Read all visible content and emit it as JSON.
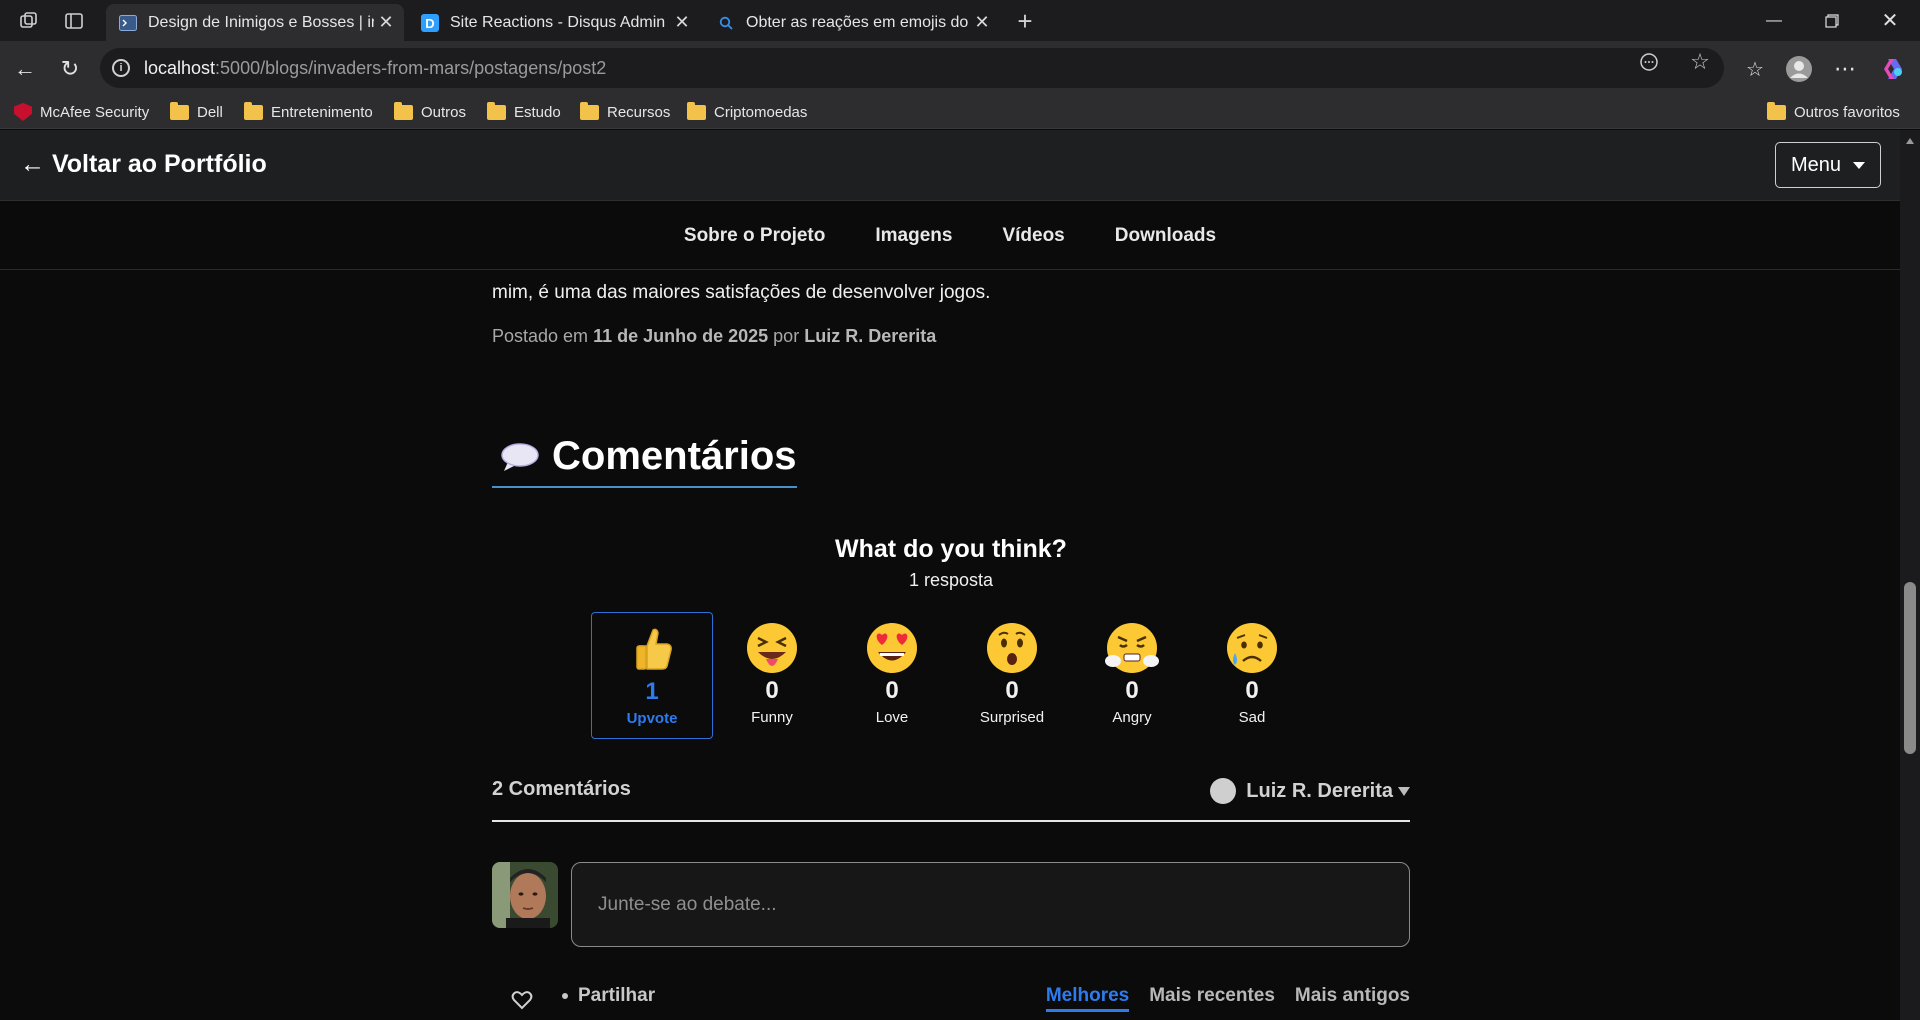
{
  "browser": {
    "tabs": [
      {
        "title": "Design de Inimigos e Bosses | invaders-from-mars",
        "favicon": "terminal-icon",
        "active": true
      },
      {
        "title": "Site Reactions - Disqus Admin",
        "favicon": "disqus-icon",
        "active": false
      },
      {
        "title": "Obter as reações em emojis do disqus",
        "favicon": "search-icon",
        "active": false
      }
    ],
    "url_host": "localhost",
    "url_path": ":5000/blogs/invaders-from-mars/postagens/post2",
    "bookmarks": [
      "McAfee Security",
      "Dell",
      "Entretenimento",
      "Outros",
      "Estudo",
      "Recursos",
      "Criptomoedas"
    ],
    "other_favorites": "Outros favoritos"
  },
  "site": {
    "back_link": "← Voltar ao Portfólio",
    "menu_label": "Menu",
    "nav": [
      "Sobre o Projeto",
      "Imagens",
      "Vídeos",
      "Downloads"
    ]
  },
  "article": {
    "text": "mim, é uma das maiores satisfações de desenvolver jogos.",
    "posted_prefix": "Postado em",
    "posted_date": "11 de Junho de 2025",
    "posted_by": "por",
    "author": "Luiz R. Dererita"
  },
  "comments": {
    "title": "Comentários",
    "reactions_title": "What do you think?",
    "reactions_subtitle": "1 resposta",
    "reactions": [
      {
        "label": "Upvote",
        "count": "1",
        "icon": "thumbs-up-icon",
        "selected": true
      },
      {
        "label": "Funny",
        "count": "0",
        "icon": "funny-face-icon",
        "selected": false
      },
      {
        "label": "Love",
        "count": "0",
        "icon": "heart-eyes-icon",
        "selected": false
      },
      {
        "label": "Surprised",
        "count": "0",
        "icon": "surprised-face-icon",
        "selected": false
      },
      {
        "label": "Angry",
        "count": "0",
        "icon": "angry-face-icon",
        "selected": false
      },
      {
        "label": "Sad",
        "count": "0",
        "icon": "sad-face-icon",
        "selected": false
      }
    ],
    "count_label": "2 Comentários",
    "user": "Luiz R. Dererita",
    "input_placeholder": "Junte-se ao debate...",
    "share_label": "Partilhar",
    "sort": [
      "Melhores",
      "Mais recentes",
      "Mais antigos"
    ],
    "accent": "#2e7bef"
  }
}
